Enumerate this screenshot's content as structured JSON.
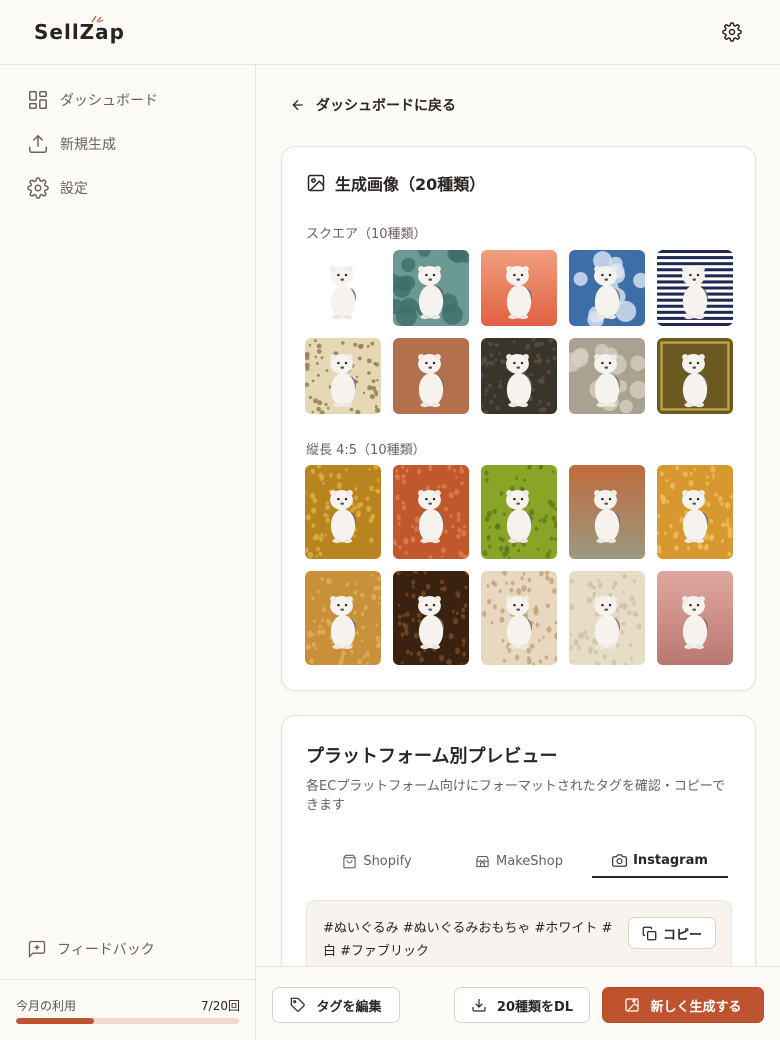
{
  "app": {
    "logo": "SellZap"
  },
  "sidebar": {
    "items": [
      {
        "label": "ダッシュボード",
        "icon": "dashboard-icon"
      },
      {
        "label": "新規生成",
        "icon": "upload-icon"
      },
      {
        "label": "設定",
        "icon": "gear-icon"
      }
    ],
    "feedback_label": "フィードバック",
    "usage": {
      "label": "今月の利用",
      "count": "7/20回",
      "progress": 0.35
    }
  },
  "main": {
    "back_label": "ダッシュボードに戻る",
    "generated": {
      "title": "生成画像（20種類）",
      "square_label": "スクエア（10種類）",
      "portrait_label": "縦長 4:5（10種類）"
    },
    "preview": {
      "title": "プラットフォーム別プレビュー",
      "description": "各ECプラットフォーム向けにフォーマットされたタグを確認・コピーできます",
      "tabs": [
        {
          "label": "Shopify",
          "icon": "shopping-bag-icon"
        },
        {
          "label": "MakeShop",
          "icon": "store-icon"
        },
        {
          "label": "Instagram",
          "icon": "camera-icon",
          "active": true
        }
      ],
      "tags": "#ぬいぐるみ #ぬいぐるみおもちゃ #ホワイト #白 #ファブリック",
      "copy_label": "コピー"
    }
  },
  "bottom": {
    "edit_tags": "タグを編集",
    "download": "20種類をDL",
    "new_generate": "新しく生成する"
  },
  "colors": {
    "accent": "#c0532f",
    "background": "#fdfbf7"
  }
}
